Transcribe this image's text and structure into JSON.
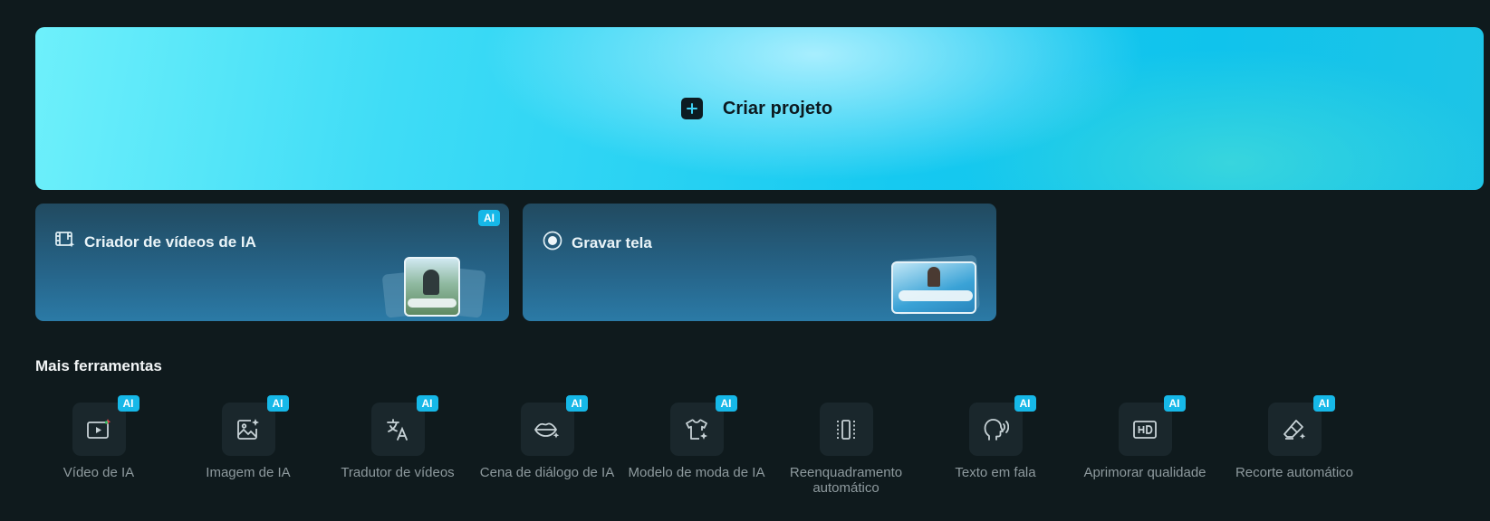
{
  "hero": {
    "label": "Criar projeto",
    "icon": "plus-icon"
  },
  "cards": [
    {
      "title": "Criador de vídeos de IA",
      "icon": "film-sparkle-icon",
      "badge": "AI"
    },
    {
      "title": "Gravar tela",
      "icon": "record-icon"
    }
  ],
  "section": {
    "title": "Mais ferramentas"
  },
  "tools": [
    {
      "label": "Vídeo de IA",
      "icon": "ai-video-icon",
      "badge": "AI"
    },
    {
      "label": "Imagem de IA",
      "icon": "ai-image-icon",
      "badge": "AI"
    },
    {
      "label": "Tradutor de vídeos",
      "icon": "translate-icon",
      "badge": "AI"
    },
    {
      "label": "Cena de diálogo de IA",
      "icon": "lips-sparkle-icon",
      "badge": "AI"
    },
    {
      "label": "Modelo de moda de IA",
      "icon": "shirt-sparkle-icon",
      "badge": "AI"
    },
    {
      "label": "Reenquadramento automático",
      "icon": "reframe-icon"
    },
    {
      "label": "Texto em fala",
      "icon": "speaking-head-icon",
      "badge": "AI"
    },
    {
      "label": "Aprimorar qualidade",
      "icon": "hd-icon",
      "badge": "AI"
    },
    {
      "label": "Recorte automático",
      "icon": "eraser-sparkle-icon",
      "badge": "AI"
    }
  ],
  "colors": {
    "accent": "#16b8e8",
    "background": "#0f1a1d",
    "card": "#26658a"
  }
}
